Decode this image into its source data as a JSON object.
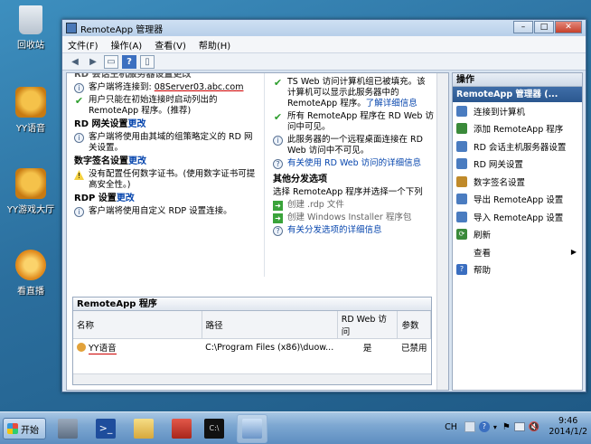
{
  "desktop": {
    "icons": [
      {
        "label": "回收站",
        "icon": "recycle-bin-icon"
      },
      {
        "label": "YY语音",
        "icon": "yy-voice-icon"
      },
      {
        "label": "YY游戏大厅",
        "icon": "yy-game-hall-icon"
      },
      {
        "label": "看直播",
        "icon": "live-stream-icon"
      }
    ]
  },
  "window": {
    "title": "RemoteApp 管理器",
    "buttons": {
      "minimize": "–",
      "maximize": "□",
      "close": "✕"
    },
    "menu": [
      "文件(F)",
      "操作(A)",
      "查看(V)",
      "帮助(H)"
    ],
    "left_col": {
      "cut_heading": "RD 会话主机服务器设置更改",
      "item1_text": "客户端将连接到:",
      "item1_value": "08Server03.abc.com",
      "item2": "用户只能在初始连接时启动列出的 RemoteApp 程序。(推荐)",
      "gateway_heading": "RD 网关设置",
      "gateway_change": "更改",
      "gateway_text": "客户端将使用由其域的组策略定义的 RD 网关设置。",
      "sign_heading": "数字签名设置",
      "sign_change": "更改",
      "sign_text": "没有配置任何数字证书。(使用数字证书可提高安全性。)",
      "rdp_heading": "RDP 设置",
      "rdp_change": "更改",
      "rdp_text": "客户端将使用自定义 RDP 设置连接。"
    },
    "right_col": {
      "r1": "TS Web 访问计算机组已被填充。该计算机可以显示此服务器中的 RemoteApp 程序。",
      "r1_link": "了解详细信息",
      "r2": "所有 RemoteApp 程序在 RD Web 访问中可见。",
      "r3": "此服务器的一个远程桌面连接在 RD Web 访问中不可见。",
      "r3_link": "有关使用 RD Web 访问的详细信息",
      "dist_heading": "其他分发选项",
      "dist_text": "选择 RemoteApp 程序并选择一个下列",
      "d1": "创建 .rdp 文件",
      "d2": "创建 Windows Installer 程序包",
      "d3": "有关分发选项的详细信息"
    },
    "programs": {
      "title": "RemoteApp 程序",
      "columns": [
        "名称",
        "路径",
        "RD Web 访问",
        "参数"
      ],
      "rows": [
        {
          "name": "YY语音",
          "path": "C:\\Program Files (x86)\\duow...",
          "web": "是",
          "args": "已禁用"
        }
      ]
    },
    "actions": {
      "title": "操作",
      "subtitle": "RemoteApp 管理器 (...",
      "items": [
        {
          "label": "连接到计算机",
          "color": "#4a7cc0"
        },
        {
          "label": "添加 RemoteApp 程序",
          "color": "#3a8a3a"
        },
        {
          "label": "RD 会话主机服务器设置",
          "color": "#4a7cc0"
        },
        {
          "label": "RD 网关设置",
          "color": "#4a7cc0"
        },
        {
          "label": "数字签名设置",
          "color": "#c08a2a"
        },
        {
          "label": "导出 RemoteApp 设置",
          "color": "#4a7cc0"
        },
        {
          "label": "导入 RemoteApp 设置",
          "color": "#4a7cc0"
        },
        {
          "label": "刷新",
          "color": "#3a8a3a"
        },
        {
          "label": "查看",
          "color": "#ffffff"
        },
        {
          "label": "帮助",
          "color": "#3a6ec0"
        }
      ]
    }
  },
  "taskbar": {
    "start": "开始",
    "lang": "CH",
    "time": "9:46",
    "date": "2014/1/2"
  }
}
